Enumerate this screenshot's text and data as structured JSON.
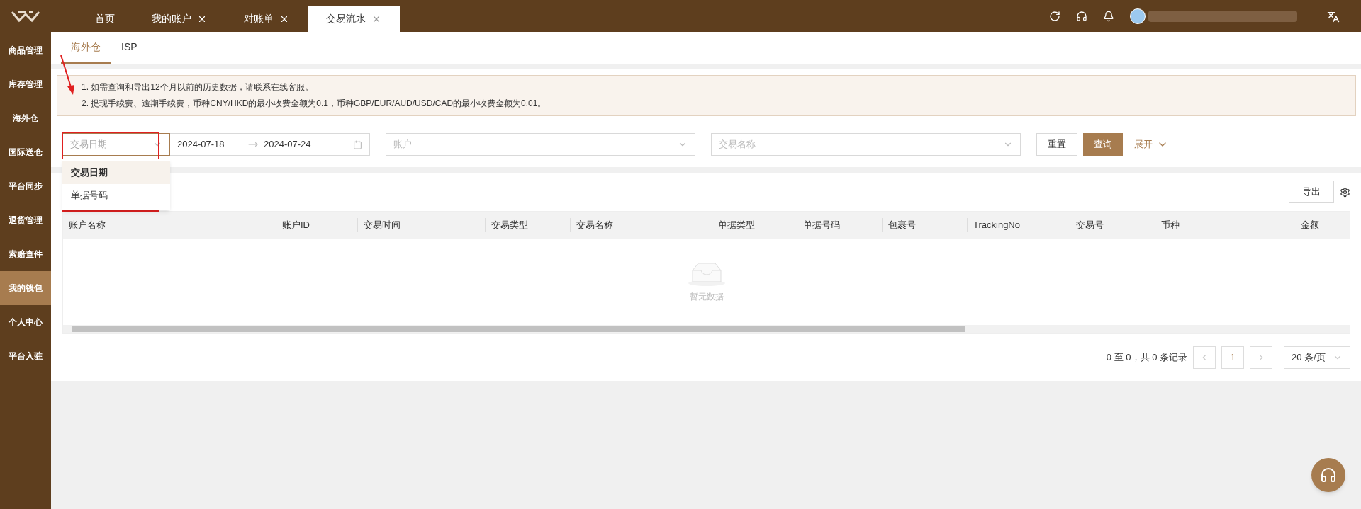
{
  "nav_tabs": [
    {
      "label": "首页",
      "closable": false,
      "selected": false
    },
    {
      "label": "我的账户",
      "closable": true,
      "selected": false
    },
    {
      "label": "对账单",
      "closable": true,
      "selected": false
    },
    {
      "label": "交易流水",
      "closable": true,
      "selected": true
    }
  ],
  "sidebar": {
    "items": [
      {
        "label": "商品管理",
        "selected": false
      },
      {
        "label": "库存管理",
        "selected": false
      },
      {
        "label": "海外仓",
        "selected": false
      },
      {
        "label": "国际送仓",
        "selected": false
      },
      {
        "label": "平台同步",
        "selected": false
      },
      {
        "label": "退货管理",
        "selected": false
      },
      {
        "label": "索赔查件",
        "selected": false
      },
      {
        "label": "我的钱包",
        "selected": true
      },
      {
        "label": "个人中心",
        "selected": false
      },
      {
        "label": "平台入驻",
        "selected": false
      }
    ]
  },
  "sub_tabs": [
    {
      "label": "海外仓",
      "selected": true
    },
    {
      "label": "ISP",
      "selected": false
    }
  ],
  "notice": [
    "1. 如需查询和导出12个月以前的历史数据，请联系在线客服。",
    "2. 提现手续费、逾期手续费，币种CNY/HKD的最小收费金额为0.1，币种GBP/EUR/AUD/USD/CAD的最小收费金额为0.01。"
  ],
  "filters": {
    "type_select": {
      "placeholder": "交易日期",
      "expanded": true,
      "options": [
        {
          "label": "交易日期",
          "selected": true
        },
        {
          "label": "单据号码",
          "selected": false
        }
      ]
    },
    "date_start": "2024-07-18",
    "date_end": "2024-07-24",
    "account": {
      "placeholder": "账户"
    },
    "transaction_name": {
      "placeholder": "交易名称"
    },
    "reset_button": "重置",
    "search_button": "查询",
    "expand_link": "展开"
  },
  "export_button": "导出",
  "table": {
    "columns": [
      {
        "label": "账户名称"
      },
      {
        "label": "账户ID"
      },
      {
        "label": "交易时间"
      },
      {
        "label": "交易类型"
      },
      {
        "label": "交易名称"
      },
      {
        "label": "单据类型"
      },
      {
        "label": "单据号码"
      },
      {
        "label": "包裹号"
      },
      {
        "label": "TrackingNo"
      },
      {
        "label": "交易号"
      },
      {
        "label": "币种"
      },
      {
        "label": "金额"
      }
    ],
    "empty_text": "暂无数据"
  },
  "pagination": {
    "summary": "0 至 0，共 0 条记录",
    "pages": [
      {
        "label": "1",
        "selected": true
      }
    ],
    "page_size": "20 条/页"
  }
}
